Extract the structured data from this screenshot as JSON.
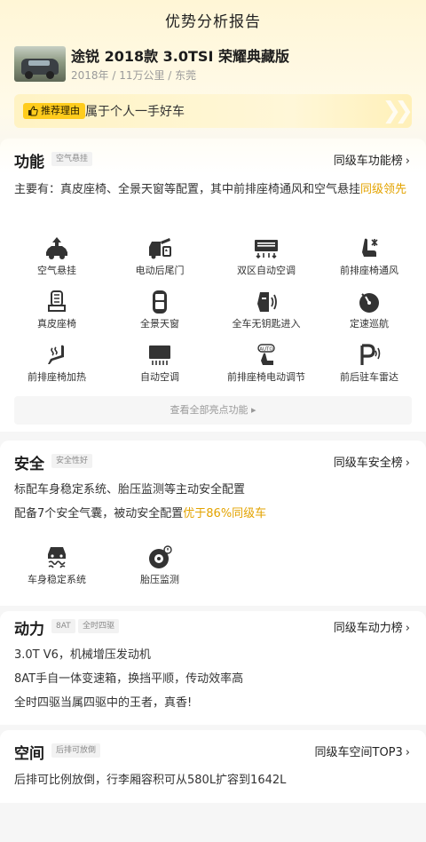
{
  "header": {
    "title": "优势分析报告"
  },
  "car": {
    "name": "途锐 2018款 3.0TSI 荣耀典藏版",
    "meta": "2018年 / 11万公里 / 东莞"
  },
  "reason": {
    "tag": "推荐理由",
    "text": "属于个人一手好车"
  },
  "function": {
    "title": "功能",
    "tag": "空气悬挂",
    "rank_link": "同级车功能榜",
    "desc_prefix": "主要有：真皮座椅、全景天窗等配置，其中前排座椅通风和空气悬挂",
    "desc_highlight": "同级领先",
    "features": [
      {
        "label": "空气悬挂",
        "icon": "air-suspension-icon"
      },
      {
        "label": "电动后尾门",
        "icon": "power-tailgate-icon"
      },
      {
        "label": "双区自动空调",
        "icon": "dual-zone-ac-icon"
      },
      {
        "label": "前排座椅通风",
        "icon": "seat-ventilation-icon"
      },
      {
        "label": "真皮座椅",
        "icon": "leather-seat-icon"
      },
      {
        "label": "全景天窗",
        "icon": "panoramic-sunroof-icon"
      },
      {
        "label": "全车无钥匙进入",
        "icon": "keyless-entry-icon"
      },
      {
        "label": "定速巡航",
        "icon": "cruise-control-icon"
      },
      {
        "label": "前排座椅加热",
        "icon": "seat-heating-icon"
      },
      {
        "label": "自动空调",
        "icon": "auto-ac-icon"
      },
      {
        "label": "前排座椅电动调节",
        "icon": "power-seat-icon"
      },
      {
        "label": "前后驻车雷达",
        "icon": "parking-radar-icon"
      }
    ],
    "more_label": "查看全部亮点功能 ▸"
  },
  "safety": {
    "title": "安全",
    "tag": "安全性好",
    "rank_link": "同级车安全榜",
    "line1": "标配车身稳定系统、胎压监测等主动安全配置",
    "line2_prefix": "配备7个安全气囊，被动安全配置",
    "line2_highlight": "优于86%同级车",
    "features": [
      {
        "label": "车身稳定系统",
        "icon": "stability-control-icon"
      },
      {
        "label": "胎压监测",
        "icon": "tire-pressure-icon"
      }
    ]
  },
  "power": {
    "title": "动力",
    "tags": [
      "8AT",
      "全时四驱"
    ],
    "rank_link": "同级车动力榜",
    "lines": [
      "3.0T V6，机械增压发动机",
      "8AT手自一体变速箱，换挡平顺，传动效率高",
      "全时四驱当属四驱中的王者，真香!"
    ]
  },
  "space": {
    "title": "空间",
    "tag": "后排可放倒",
    "rank_link": "同级车空间TOP3",
    "line": "后排可比例放倒，行李厢容积可从580L扩容到1642L"
  },
  "colors": {
    "accent": "#ffcc1d",
    "highlight": "#e3a300",
    "background": "#f6f6f6"
  }
}
